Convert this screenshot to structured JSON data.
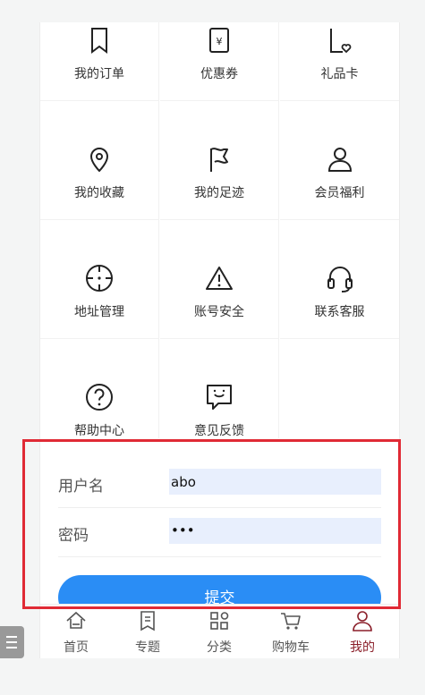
{
  "grid": {
    "items": [
      {
        "label": "我的订单",
        "icon": "bookmark-icon"
      },
      {
        "label": "优惠券",
        "icon": "coupon-icon"
      },
      {
        "label": "礼品卡",
        "icon": "gift-card-icon"
      },
      {
        "label": "我的收藏",
        "icon": "location-pin-icon"
      },
      {
        "label": "我的足迹",
        "icon": "flag-icon"
      },
      {
        "label": "会员福利",
        "icon": "user-icon"
      },
      {
        "label": "地址管理",
        "icon": "crosshair-icon"
      },
      {
        "label": "账号安全",
        "icon": "warning-icon"
      },
      {
        "label": "联系客服",
        "icon": "headset-icon"
      },
      {
        "label": "帮助中心",
        "icon": "help-icon"
      },
      {
        "label": "意见反馈",
        "icon": "feedback-icon"
      }
    ]
  },
  "form": {
    "username_label": "用户名",
    "username_value": "abo",
    "password_label": "密码",
    "password_value": "•••",
    "submit_label": "提交"
  },
  "tabbar": {
    "tabs": [
      {
        "label": "首页",
        "icon": "home-icon"
      },
      {
        "label": "专题",
        "icon": "topic-icon"
      },
      {
        "label": "分类",
        "icon": "category-icon"
      },
      {
        "label": "购物车",
        "icon": "cart-icon"
      },
      {
        "label": "我的",
        "icon": "profile-icon",
        "active": true
      }
    ]
  },
  "colors": {
    "accent": "#2a8df5",
    "active_tab": "#8b1f2a",
    "highlight": "#e02a35"
  }
}
